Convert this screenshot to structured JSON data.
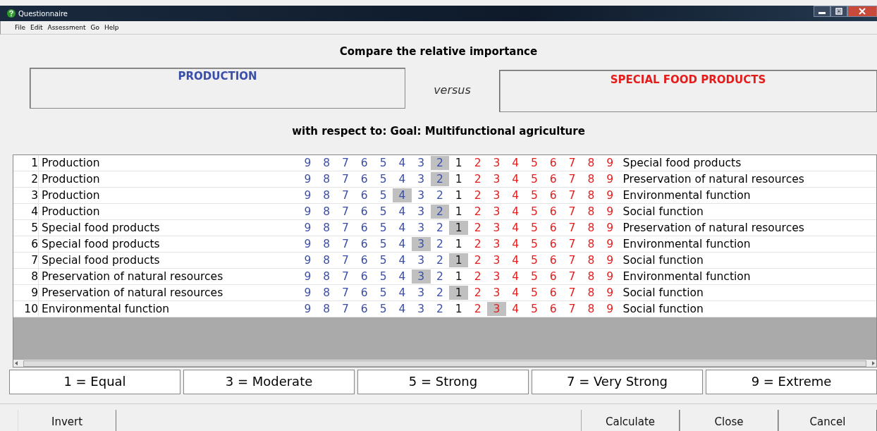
{
  "window": {
    "title": "Questionnaire"
  },
  "menu": [
    {
      "label": "File"
    },
    {
      "label": "Edit"
    },
    {
      "label": "Assessment"
    },
    {
      "label": "Go"
    },
    {
      "label": "Help"
    }
  ],
  "heading": "Compare the relative importance",
  "left_box": "PRODUCTION",
  "versus": "versus",
  "right_box": "SPECIAL FOOD PRODUCTS",
  "respect": "with respect to: Goal: Multifunctional agriculture",
  "rows": [
    {
      "num": "1",
      "left": "Production",
      "right": "Special food products",
      "cells": [
        {
          "n": "9",
          "kind": "left",
          "selected": false
        },
        {
          "n": "8",
          "kind": "left",
          "selected": false
        },
        {
          "n": "7",
          "kind": "left",
          "selected": false
        },
        {
          "n": "6",
          "kind": "left",
          "selected": false
        },
        {
          "n": "5",
          "kind": "left",
          "selected": false
        },
        {
          "n": "4",
          "kind": "left",
          "selected": false
        },
        {
          "n": "3",
          "kind": "left",
          "selected": false
        },
        {
          "n": "2",
          "kind": "left",
          "selected": true
        },
        {
          "n": "1",
          "kind": "equal",
          "selected": false
        },
        {
          "n": "2",
          "kind": "right",
          "selected": false
        },
        {
          "n": "3",
          "kind": "right",
          "selected": false
        },
        {
          "n": "4",
          "kind": "right",
          "selected": false
        },
        {
          "n": "5",
          "kind": "right",
          "selected": false
        },
        {
          "n": "6",
          "kind": "right",
          "selected": false
        },
        {
          "n": "7",
          "kind": "right",
          "selected": false
        },
        {
          "n": "8",
          "kind": "right",
          "selected": false
        },
        {
          "n": "9",
          "kind": "right",
          "selected": false
        }
      ]
    },
    {
      "num": "2",
      "left": "Production",
      "right": "Preservation of natural resources",
      "cells": [
        {
          "n": "9",
          "kind": "left",
          "selected": false
        },
        {
          "n": "8",
          "kind": "left",
          "selected": false
        },
        {
          "n": "7",
          "kind": "left",
          "selected": false
        },
        {
          "n": "6",
          "kind": "left",
          "selected": false
        },
        {
          "n": "5",
          "kind": "left",
          "selected": false
        },
        {
          "n": "4",
          "kind": "left",
          "selected": false
        },
        {
          "n": "3",
          "kind": "left",
          "selected": false
        },
        {
          "n": "2",
          "kind": "left",
          "selected": true
        },
        {
          "n": "1",
          "kind": "equal",
          "selected": false
        },
        {
          "n": "2",
          "kind": "right",
          "selected": false
        },
        {
          "n": "3",
          "kind": "right",
          "selected": false
        },
        {
          "n": "4",
          "kind": "right",
          "selected": false
        },
        {
          "n": "5",
          "kind": "right",
          "selected": false
        },
        {
          "n": "6",
          "kind": "right",
          "selected": false
        },
        {
          "n": "7",
          "kind": "right",
          "selected": false
        },
        {
          "n": "8",
          "kind": "right",
          "selected": false
        },
        {
          "n": "9",
          "kind": "right",
          "selected": false
        }
      ]
    },
    {
      "num": "3",
      "left": "Production",
      "right": "Environmental function",
      "cells": [
        {
          "n": "9",
          "kind": "left",
          "selected": false
        },
        {
          "n": "8",
          "kind": "left",
          "selected": false
        },
        {
          "n": "7",
          "kind": "left",
          "selected": false
        },
        {
          "n": "6",
          "kind": "left",
          "selected": false
        },
        {
          "n": "5",
          "kind": "left",
          "selected": false
        },
        {
          "n": "4",
          "kind": "left",
          "selected": true
        },
        {
          "n": "3",
          "kind": "left",
          "selected": false
        },
        {
          "n": "2",
          "kind": "left",
          "selected": false
        },
        {
          "n": "1",
          "kind": "equal",
          "selected": false
        },
        {
          "n": "2",
          "kind": "right",
          "selected": false
        },
        {
          "n": "3",
          "kind": "right",
          "selected": false
        },
        {
          "n": "4",
          "kind": "right",
          "selected": false
        },
        {
          "n": "5",
          "kind": "right",
          "selected": false
        },
        {
          "n": "6",
          "kind": "right",
          "selected": false
        },
        {
          "n": "7",
          "kind": "right",
          "selected": false
        },
        {
          "n": "8",
          "kind": "right",
          "selected": false
        },
        {
          "n": "9",
          "kind": "right",
          "selected": false
        }
      ]
    },
    {
      "num": "4",
      "left": "Production",
      "right": "Social function",
      "cells": [
        {
          "n": "9",
          "kind": "left",
          "selected": false
        },
        {
          "n": "8",
          "kind": "left",
          "selected": false
        },
        {
          "n": "7",
          "kind": "left",
          "selected": false
        },
        {
          "n": "6",
          "kind": "left",
          "selected": false
        },
        {
          "n": "5",
          "kind": "left",
          "selected": false
        },
        {
          "n": "4",
          "kind": "left",
          "selected": false
        },
        {
          "n": "3",
          "kind": "left",
          "selected": false
        },
        {
          "n": "2",
          "kind": "left",
          "selected": true
        },
        {
          "n": "1",
          "kind": "equal",
          "selected": false
        },
        {
          "n": "2",
          "kind": "right",
          "selected": false
        },
        {
          "n": "3",
          "kind": "right",
          "selected": false
        },
        {
          "n": "4",
          "kind": "right",
          "selected": false
        },
        {
          "n": "5",
          "kind": "right",
          "selected": false
        },
        {
          "n": "6",
          "kind": "right",
          "selected": false
        },
        {
          "n": "7",
          "kind": "right",
          "selected": false
        },
        {
          "n": "8",
          "kind": "right",
          "selected": false
        },
        {
          "n": "9",
          "kind": "right",
          "selected": false
        }
      ]
    },
    {
      "num": "5",
      "left": "Special food products",
      "right": "Preservation of natural resources",
      "cells": [
        {
          "n": "9",
          "kind": "left",
          "selected": false
        },
        {
          "n": "8",
          "kind": "left",
          "selected": false
        },
        {
          "n": "7",
          "kind": "left",
          "selected": false
        },
        {
          "n": "6",
          "kind": "left",
          "selected": false
        },
        {
          "n": "5",
          "kind": "left",
          "selected": false
        },
        {
          "n": "4",
          "kind": "left",
          "selected": false
        },
        {
          "n": "3",
          "kind": "left",
          "selected": false
        },
        {
          "n": "2",
          "kind": "left",
          "selected": false
        },
        {
          "n": "1",
          "kind": "equal",
          "selected": true
        },
        {
          "n": "2",
          "kind": "right",
          "selected": false
        },
        {
          "n": "3",
          "kind": "right",
          "selected": false
        },
        {
          "n": "4",
          "kind": "right",
          "selected": false
        },
        {
          "n": "5",
          "kind": "right",
          "selected": false
        },
        {
          "n": "6",
          "kind": "right",
          "selected": false
        },
        {
          "n": "7",
          "kind": "right",
          "selected": false
        },
        {
          "n": "8",
          "kind": "right",
          "selected": false
        },
        {
          "n": "9",
          "kind": "right",
          "selected": false
        }
      ]
    },
    {
      "num": "6",
      "left": "Special food products",
      "right": "Environmental function",
      "cells": [
        {
          "n": "9",
          "kind": "left",
          "selected": false
        },
        {
          "n": "8",
          "kind": "left",
          "selected": false
        },
        {
          "n": "7",
          "kind": "left",
          "selected": false
        },
        {
          "n": "6",
          "kind": "left",
          "selected": false
        },
        {
          "n": "5",
          "kind": "left",
          "selected": false
        },
        {
          "n": "4",
          "kind": "left",
          "selected": false
        },
        {
          "n": "3",
          "kind": "left",
          "selected": true
        },
        {
          "n": "2",
          "kind": "left",
          "selected": false
        },
        {
          "n": "1",
          "kind": "equal",
          "selected": false
        },
        {
          "n": "2",
          "kind": "right",
          "selected": false
        },
        {
          "n": "3",
          "kind": "right",
          "selected": false
        },
        {
          "n": "4",
          "kind": "right",
          "selected": false
        },
        {
          "n": "5",
          "kind": "right",
          "selected": false
        },
        {
          "n": "6",
          "kind": "right",
          "selected": false
        },
        {
          "n": "7",
          "kind": "right",
          "selected": false
        },
        {
          "n": "8",
          "kind": "right",
          "selected": false
        },
        {
          "n": "9",
          "kind": "right",
          "selected": false
        }
      ]
    },
    {
      "num": "7",
      "left": "Special food products",
      "right": "Social function",
      "cells": [
        {
          "n": "9",
          "kind": "left",
          "selected": false
        },
        {
          "n": "8",
          "kind": "left",
          "selected": false
        },
        {
          "n": "7",
          "kind": "left",
          "selected": false
        },
        {
          "n": "6",
          "kind": "left",
          "selected": false
        },
        {
          "n": "5",
          "kind": "left",
          "selected": false
        },
        {
          "n": "4",
          "kind": "left",
          "selected": false
        },
        {
          "n": "3",
          "kind": "left",
          "selected": false
        },
        {
          "n": "2",
          "kind": "left",
          "selected": false
        },
        {
          "n": "1",
          "kind": "equal",
          "selected": true
        },
        {
          "n": "2",
          "kind": "right",
          "selected": false
        },
        {
          "n": "3",
          "kind": "right",
          "selected": false
        },
        {
          "n": "4",
          "kind": "right",
          "selected": false
        },
        {
          "n": "5",
          "kind": "right",
          "selected": false
        },
        {
          "n": "6",
          "kind": "right",
          "selected": false
        },
        {
          "n": "7",
          "kind": "right",
          "selected": false
        },
        {
          "n": "8",
          "kind": "right",
          "selected": false
        },
        {
          "n": "9",
          "kind": "right",
          "selected": false
        }
      ]
    },
    {
      "num": "8",
      "left": "Preservation of natural resources",
      "right": "Environmental function",
      "cells": [
        {
          "n": "9",
          "kind": "left",
          "selected": false
        },
        {
          "n": "8",
          "kind": "left",
          "selected": false
        },
        {
          "n": "7",
          "kind": "left",
          "selected": false
        },
        {
          "n": "6",
          "kind": "left",
          "selected": false
        },
        {
          "n": "5",
          "kind": "left",
          "selected": false
        },
        {
          "n": "4",
          "kind": "left",
          "selected": false
        },
        {
          "n": "3",
          "kind": "left",
          "selected": true
        },
        {
          "n": "2",
          "kind": "left",
          "selected": false
        },
        {
          "n": "1",
          "kind": "equal",
          "selected": false
        },
        {
          "n": "2",
          "kind": "right",
          "selected": false
        },
        {
          "n": "3",
          "kind": "right",
          "selected": false
        },
        {
          "n": "4",
          "kind": "right",
          "selected": false
        },
        {
          "n": "5",
          "kind": "right",
          "selected": false
        },
        {
          "n": "6",
          "kind": "right",
          "selected": false
        },
        {
          "n": "7",
          "kind": "right",
          "selected": false
        },
        {
          "n": "8",
          "kind": "right",
          "selected": false
        },
        {
          "n": "9",
          "kind": "right",
          "selected": false
        }
      ]
    },
    {
      "num": "9",
      "left": "Preservation of natural resources",
      "right": "Social function",
      "cells": [
        {
          "n": "9",
          "kind": "left",
          "selected": false
        },
        {
          "n": "8",
          "kind": "left",
          "selected": false
        },
        {
          "n": "7",
          "kind": "left",
          "selected": false
        },
        {
          "n": "6",
          "kind": "left",
          "selected": false
        },
        {
          "n": "5",
          "kind": "left",
          "selected": false
        },
        {
          "n": "4",
          "kind": "left",
          "selected": false
        },
        {
          "n": "3",
          "kind": "left",
          "selected": false
        },
        {
          "n": "2",
          "kind": "left",
          "selected": false
        },
        {
          "n": "1",
          "kind": "equal",
          "selected": true
        },
        {
          "n": "2",
          "kind": "right",
          "selected": false
        },
        {
          "n": "3",
          "kind": "right",
          "selected": false
        },
        {
          "n": "4",
          "kind": "right",
          "selected": false
        },
        {
          "n": "5",
          "kind": "right",
          "selected": false
        },
        {
          "n": "6",
          "kind": "right",
          "selected": false
        },
        {
          "n": "7",
          "kind": "right",
          "selected": false
        },
        {
          "n": "8",
          "kind": "right",
          "selected": false
        },
        {
          "n": "9",
          "kind": "right",
          "selected": false
        }
      ]
    },
    {
      "num": "10",
      "left": "Environmental function",
      "right": "Social function",
      "cells": [
        {
          "n": "9",
          "kind": "left",
          "selected": false
        },
        {
          "n": "8",
          "kind": "left",
          "selected": false
        },
        {
          "n": "7",
          "kind": "left",
          "selected": false
        },
        {
          "n": "6",
          "kind": "left",
          "selected": false
        },
        {
          "n": "5",
          "kind": "left",
          "selected": false
        },
        {
          "n": "4",
          "kind": "left",
          "selected": false
        },
        {
          "n": "3",
          "kind": "left",
          "selected": false
        },
        {
          "n": "2",
          "kind": "left",
          "selected": false
        },
        {
          "n": "1",
          "kind": "equal",
          "selected": false
        },
        {
          "n": "2",
          "kind": "right",
          "selected": false
        },
        {
          "n": "3",
          "kind": "right",
          "selected": true
        },
        {
          "n": "4",
          "kind": "right",
          "selected": false
        },
        {
          "n": "5",
          "kind": "right",
          "selected": false
        },
        {
          "n": "6",
          "kind": "right",
          "selected": false
        },
        {
          "n": "7",
          "kind": "right",
          "selected": false
        },
        {
          "n": "8",
          "kind": "right",
          "selected": false
        },
        {
          "n": "9",
          "kind": "right",
          "selected": false
        }
      ]
    }
  ],
  "legend": [
    "1 = Equal",
    "3 = Moderate",
    "5 = Strong",
    "7 = Very Strong",
    "9 = Extreme"
  ],
  "buttons_left": [
    "Invert"
  ],
  "buttons_right": [
    "Calculate",
    "Close",
    "Cancel"
  ]
}
